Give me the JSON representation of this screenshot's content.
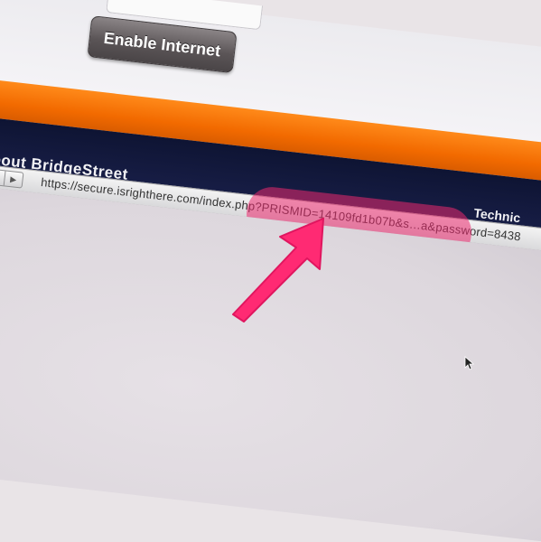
{
  "form": {
    "enable_button_label": "Enable Internet"
  },
  "footer": {
    "about_heading": "About BridgeStreet",
    "right_heading": "Technic"
  },
  "status_bar": {
    "url": "https://secure.isrighthere.com/index.php?PRISMID=14109fd1b07b&s…a&password=8438"
  },
  "colors": {
    "orange_band": "#f26a00",
    "navy_band": "#141a3f",
    "highlight": "#eb286e"
  },
  "icons": {
    "back": "left-triangle",
    "forward": "right-triangle",
    "annotation": "arrow",
    "cursor": "mouse-pointer"
  }
}
